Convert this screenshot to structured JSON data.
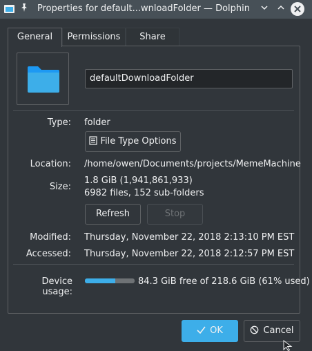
{
  "window": {
    "title": "Properties for default...wnloadFolder — Dolphin",
    "pin_icon": "pin-icon",
    "app_icon": "dolphin-icon"
  },
  "tabs": [
    {
      "label": "General",
      "active": true
    },
    {
      "label": "Permissions",
      "active": false
    },
    {
      "label": "Share",
      "active": false
    }
  ],
  "general": {
    "folder_name": "defaultDownloadFolder",
    "type_label": "Type:",
    "type_value": "folder",
    "file_type_options_label": "File Type Options",
    "location_label": "Location:",
    "location_value": "/home/owen/Documents/projects/MemeMachine",
    "size_label": "Size:",
    "size_value": "1.8 GiB (1,941,861,933)",
    "size_counts": "6982 files, 152 sub-folders",
    "refresh_label": "Refresh",
    "stop_label": "Stop",
    "modified_label": "Modified:",
    "modified_value": "Thursday, November 22, 2018 2:13:10 PM EST",
    "accessed_label": "Accessed:",
    "accessed_value": "Thursday, November 22, 2018 2:12:57 PM EST",
    "device_usage_label": "Device usage:",
    "device_usage_value": "84.3 GiB free of 218.6 GiB (61% used)",
    "device_usage_fraction": 0.61
  },
  "footer": {
    "ok_label": "OK",
    "cancel_label": "Cancel"
  },
  "colors": {
    "accent": "#3daee9",
    "background": "#31363b",
    "titlebar": "#475057"
  }
}
